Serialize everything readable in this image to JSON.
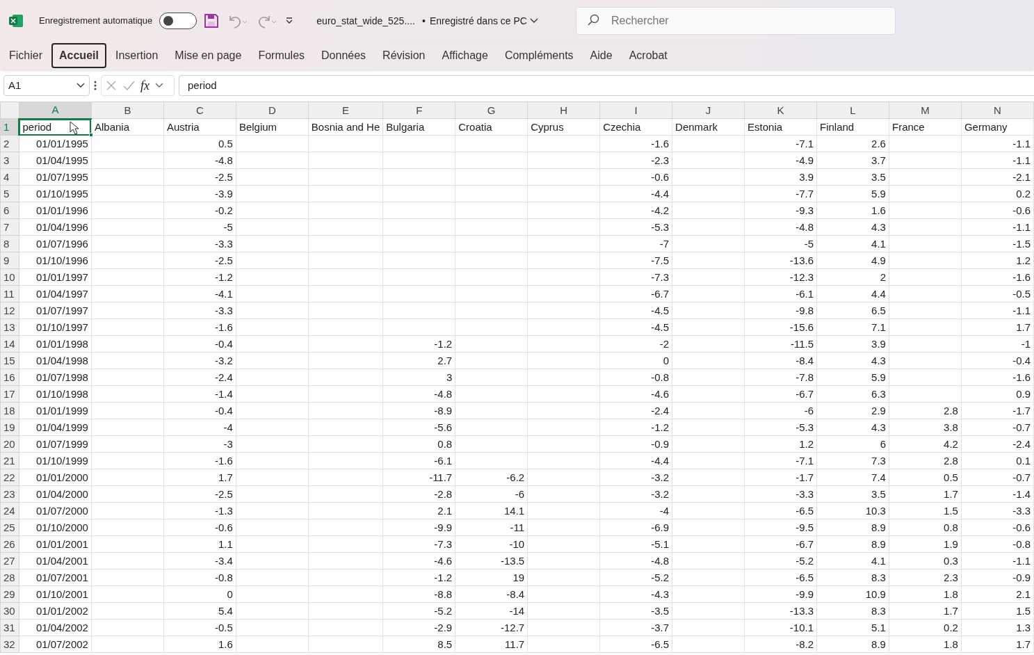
{
  "title_bar": {
    "autosave_label": "Enregistrement automatique",
    "autosave_on": false,
    "file_name": "euro_stat_wide_525....",
    "separator": "•",
    "save_status": "Enregistré dans ce PC",
    "search": {
      "placeholder": "Rechercher"
    }
  },
  "ribbon_tabs": [
    {
      "label": "Fichier",
      "selected": false
    },
    {
      "label": "Accueil",
      "selected": true
    },
    {
      "label": "Insertion",
      "selected": false
    },
    {
      "label": "Mise en page",
      "selected": false
    },
    {
      "label": "Formules",
      "selected": false
    },
    {
      "label": "Données",
      "selected": false
    },
    {
      "label": "Révision",
      "selected": false
    },
    {
      "label": "Affichage",
      "selected": false
    },
    {
      "label": "Compléments",
      "selected": false
    },
    {
      "label": "Aide",
      "selected": false
    },
    {
      "label": "Acrobat",
      "selected": false
    }
  ],
  "formula_bar": {
    "name_box": "A1",
    "fx": "fx",
    "value": "period"
  },
  "sheet": {
    "columns": [
      {
        "label": "A",
        "selected": true
      },
      {
        "label": "B",
        "selected": false
      },
      {
        "label": "C",
        "selected": false
      },
      {
        "label": "D",
        "selected": false
      },
      {
        "label": "E",
        "selected": false
      },
      {
        "label": "F",
        "selected": false
      },
      {
        "label": "G",
        "selected": false
      },
      {
        "label": "H",
        "selected": false
      },
      {
        "label": "I",
        "selected": false
      },
      {
        "label": "J",
        "selected": false
      },
      {
        "label": "K",
        "selected": false
      },
      {
        "label": "L",
        "selected": false
      },
      {
        "label": "M",
        "selected": false
      },
      {
        "label": "N",
        "selected": false
      }
    ],
    "rows": [
      {
        "number": "1",
        "selected": true,
        "cells": [
          "period",
          "Albania",
          "Austria",
          "Belgium",
          "Bosnia and He",
          "Bulgaria",
          "Croatia",
          "Cyprus",
          "Czechia",
          "Denmark",
          "Estonia",
          "Finland",
          "France",
          "Germany"
        ]
      },
      {
        "number": "2",
        "selected": false,
        "cells": [
          "01/01/1995",
          null,
          "0.5",
          null,
          null,
          null,
          null,
          null,
          "-1.6",
          null,
          "-7.1",
          "2.6",
          null,
          "-1.1"
        ]
      },
      {
        "number": "3",
        "selected": false,
        "cells": [
          "01/04/1995",
          null,
          "-4.8",
          null,
          null,
          null,
          null,
          null,
          "-2.3",
          null,
          "-4.9",
          "3.7",
          null,
          "-1.1"
        ]
      },
      {
        "number": "4",
        "selected": false,
        "cells": [
          "01/07/1995",
          null,
          "-2.5",
          null,
          null,
          null,
          null,
          null,
          "-0.6",
          null,
          "3.9",
          "3.5",
          null,
          "-2.1"
        ]
      },
      {
        "number": "5",
        "selected": false,
        "cells": [
          "01/10/1995",
          null,
          "-3.9",
          null,
          null,
          null,
          null,
          null,
          "-4.4",
          null,
          "-7.7",
          "5.9",
          null,
          "0.2"
        ]
      },
      {
        "number": "6",
        "selected": false,
        "cells": [
          "01/01/1996",
          null,
          "-0.2",
          null,
          null,
          null,
          null,
          null,
          "-4.2",
          null,
          "-9.3",
          "1.6",
          null,
          "-0.6"
        ]
      },
      {
        "number": "7",
        "selected": false,
        "cells": [
          "01/04/1996",
          null,
          "-5",
          null,
          null,
          null,
          null,
          null,
          "-5.3",
          null,
          "-4.8",
          "4.3",
          null,
          "-1.1"
        ]
      },
      {
        "number": "8",
        "selected": false,
        "cells": [
          "01/07/1996",
          null,
          "-3.3",
          null,
          null,
          null,
          null,
          null,
          "-7",
          null,
          "-5",
          "4.1",
          null,
          "-1.5"
        ]
      },
      {
        "number": "9",
        "selected": false,
        "cells": [
          "01/10/1996",
          null,
          "-2.5",
          null,
          null,
          null,
          null,
          null,
          "-7.5",
          null,
          "-13.6",
          "4.9",
          null,
          "1.2"
        ]
      },
      {
        "number": "10",
        "selected": false,
        "cells": [
          "01/01/1997",
          null,
          "-1.2",
          null,
          null,
          null,
          null,
          null,
          "-7.3",
          null,
          "-12.3",
          "2",
          null,
          "-1.6"
        ]
      },
      {
        "number": "11",
        "selected": false,
        "cells": [
          "01/04/1997",
          null,
          "-4.1",
          null,
          null,
          null,
          null,
          null,
          "-6.7",
          null,
          "-6.1",
          "4.4",
          null,
          "-0.5"
        ]
      },
      {
        "number": "12",
        "selected": false,
        "cells": [
          "01/07/1997",
          null,
          "-3.3",
          null,
          null,
          null,
          null,
          null,
          "-4.5",
          null,
          "-9.8",
          "6.5",
          null,
          "-1.1"
        ]
      },
      {
        "number": "13",
        "selected": false,
        "cells": [
          "01/10/1997",
          null,
          "-1.6",
          null,
          null,
          null,
          null,
          null,
          "-4.5",
          null,
          "-15.6",
          "7.1",
          null,
          "1.7"
        ]
      },
      {
        "number": "14",
        "selected": false,
        "cells": [
          "01/01/1998",
          null,
          "-0.4",
          null,
          null,
          "-1.2",
          null,
          null,
          "-2",
          null,
          "-11.5",
          "3.9",
          null,
          "-1"
        ]
      },
      {
        "number": "15",
        "selected": false,
        "cells": [
          "01/04/1998",
          null,
          "-3.2",
          null,
          null,
          "2.7",
          null,
          null,
          "0",
          null,
          "-8.4",
          "4.3",
          null,
          "-0.4"
        ]
      },
      {
        "number": "16",
        "selected": false,
        "cells": [
          "01/07/1998",
          null,
          "-2.4",
          null,
          null,
          "3",
          null,
          null,
          "-0.8",
          null,
          "-7.8",
          "5.9",
          null,
          "-1.6"
        ]
      },
      {
        "number": "17",
        "selected": false,
        "cells": [
          "01/10/1998",
          null,
          "-1.4",
          null,
          null,
          "-4.8",
          null,
          null,
          "-4.6",
          null,
          "-6.7",
          "6.3",
          null,
          "0.9"
        ]
      },
      {
        "number": "18",
        "selected": false,
        "cells": [
          "01/01/1999",
          null,
          "-0.4",
          null,
          null,
          "-8.9",
          null,
          null,
          "-2.4",
          null,
          "-6",
          "2.9",
          "2.8",
          "-1.7"
        ]
      },
      {
        "number": "19",
        "selected": false,
        "cells": [
          "01/04/1999",
          null,
          "-4",
          null,
          null,
          "-5.6",
          null,
          null,
          "-1.2",
          null,
          "-5.3",
          "4.3",
          "3.8",
          "-0.7"
        ]
      },
      {
        "number": "20",
        "selected": false,
        "cells": [
          "01/07/1999",
          null,
          "-3",
          null,
          null,
          "0.8",
          null,
          null,
          "-0.9",
          null,
          "1.2",
          "6",
          "4.2",
          "-2.4"
        ]
      },
      {
        "number": "21",
        "selected": false,
        "cells": [
          "01/10/1999",
          null,
          "-1.6",
          null,
          null,
          "-6.1",
          null,
          null,
          "-4.4",
          null,
          "-7.1",
          "7.3",
          "2.8",
          "0.1"
        ]
      },
      {
        "number": "22",
        "selected": false,
        "cells": [
          "01/01/2000",
          null,
          "1.7",
          null,
          null,
          "-11.7",
          "-6.2",
          null,
          "-3.2",
          null,
          "-1.7",
          "7.4",
          "0.5",
          "-0.7"
        ]
      },
      {
        "number": "23",
        "selected": false,
        "cells": [
          "01/04/2000",
          null,
          "-2.5",
          null,
          null,
          "-2.8",
          "-6",
          null,
          "-3.2",
          null,
          "-3.3",
          "3.5",
          "1.7",
          "-1.4"
        ]
      },
      {
        "number": "24",
        "selected": false,
        "cells": [
          "01/07/2000",
          null,
          "-1.3",
          null,
          null,
          "2.1",
          "14.1",
          null,
          "-4",
          null,
          "-6.5",
          "10.3",
          "1.5",
          "-3.3"
        ]
      },
      {
        "number": "25",
        "selected": false,
        "cells": [
          "01/10/2000",
          null,
          "-0.6",
          null,
          null,
          "-9.9",
          "-11",
          null,
          "-6.9",
          null,
          "-9.5",
          "8.9",
          "0.8",
          "-0.6"
        ]
      },
      {
        "number": "26",
        "selected": false,
        "cells": [
          "01/01/2001",
          null,
          "1.1",
          null,
          null,
          "-7.3",
          "-10",
          null,
          "-5.1",
          null,
          "-6.7",
          "8.9",
          "1.9",
          "-0.8"
        ]
      },
      {
        "number": "27",
        "selected": false,
        "cells": [
          "01/04/2001",
          null,
          "-3.4",
          null,
          null,
          "-4.6",
          "-13.5",
          null,
          "-4.8",
          null,
          "-5.2",
          "4.1",
          "0.3",
          "-1.1"
        ]
      },
      {
        "number": "28",
        "selected": false,
        "cells": [
          "01/07/2001",
          null,
          "-0.8",
          null,
          null,
          "-1.2",
          "19",
          null,
          "-5.2",
          null,
          "-6.5",
          "8.3",
          "2.3",
          "-0.9"
        ]
      },
      {
        "number": "29",
        "selected": false,
        "cells": [
          "01/10/2001",
          null,
          "0",
          null,
          null,
          "-8.8",
          "-8.4",
          null,
          "-4.3",
          null,
          "-9.9",
          "10.9",
          "1.8",
          "2.1"
        ]
      },
      {
        "number": "30",
        "selected": false,
        "cells": [
          "01/01/2002",
          null,
          "5.4",
          null,
          null,
          "-5.2",
          "-14",
          null,
          "-3.5",
          null,
          "-13.3",
          "8.3",
          "1.7",
          "1.5"
        ]
      },
      {
        "number": "31",
        "selected": false,
        "cells": [
          "01/04/2002",
          null,
          "-0.5",
          null,
          null,
          "-2.9",
          "-12.7",
          null,
          "-3.7",
          null,
          "-10.1",
          "5.1",
          "0.2",
          "1.3"
        ]
      },
      {
        "number": "32",
        "selected": false,
        "cells": [
          "01/07/2002",
          null,
          "1.6",
          null,
          null,
          "8.5",
          "11.7",
          null,
          "-6.5",
          null,
          "-8.2",
          "8.9",
          "1.8",
          "1.7"
        ]
      }
    ]
  }
}
